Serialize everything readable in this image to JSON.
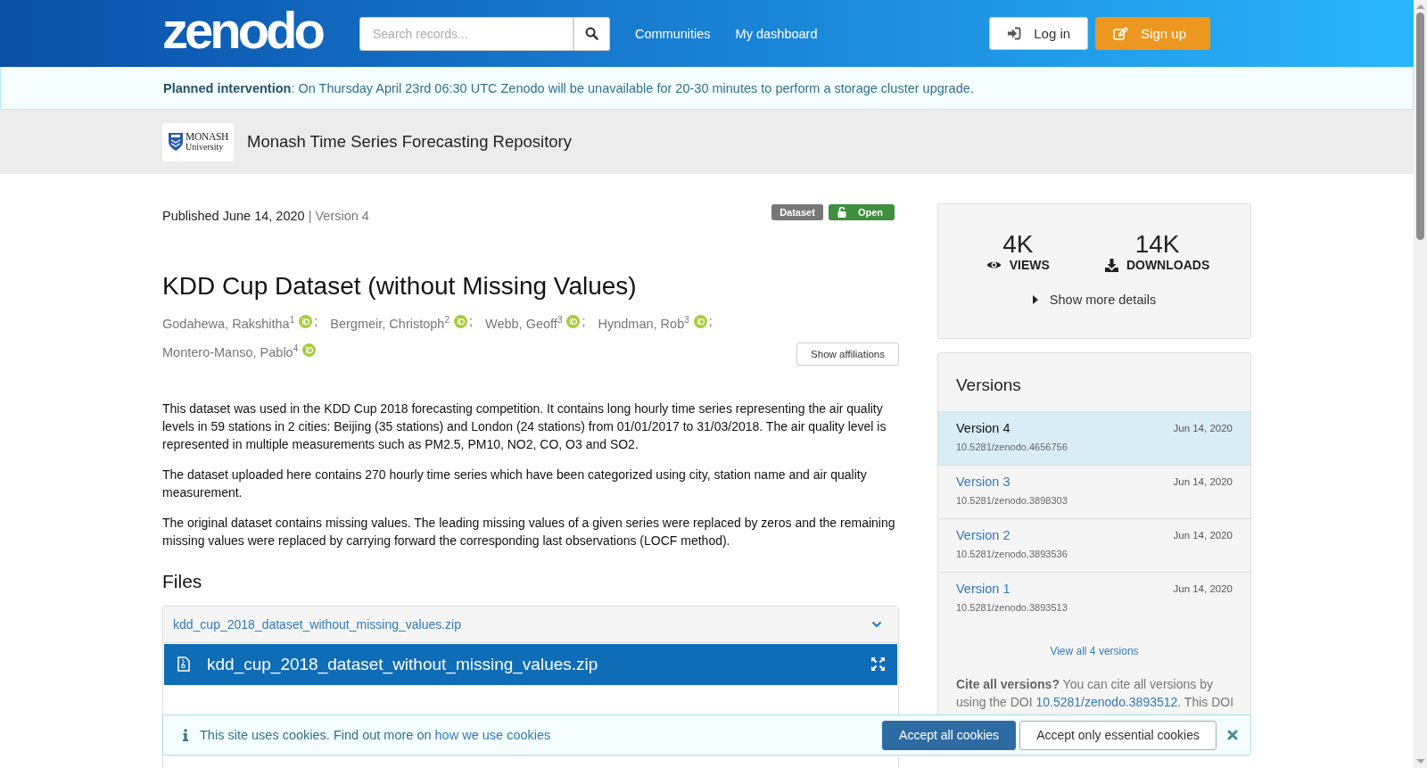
{
  "header": {
    "logo": "zenodo",
    "search": {
      "placeholder": "Search records..."
    },
    "nav": [
      "Communities",
      "My dashboard"
    ],
    "buttons": [
      {
        "kind": "login",
        "label": "Log in"
      },
      {
        "kind": "signup",
        "label": "Sign up"
      }
    ]
  },
  "announcement": "**Planned intervention**: On Thursday April 23rd 06:30 UTC Zenodo will be unavailable for 20-30 minutes to perform a storage cluster upgrade.",
  "community": {
    "logo_lines": [
      "MONASH",
      "University"
    ],
    "title": "Monash Time Series Forecasting Repository"
  },
  "record": {
    "published": "Published June 14, 2020",
    "version": "| Version 4",
    "badges": [
      {
        "kind": "type",
        "label": "Dataset"
      },
      {
        "kind": "access",
        "label": "Open"
      }
    ],
    "title": "KDD Cup Dataset (without Missing Values)",
    "authors": [
      {
        "name": "Godahewa, Rakshitha$^{1}$",
        "separator": ";"
      },
      {
        "name": "Bergmeir, Christoph$^{2}$",
        "separator": ";"
      },
      {
        "name": "Webb, Geoff$^{3}$",
        "separator": ";"
      },
      {
        "name": "Hyndman, Rob$^{3}$",
        "separator": ";"
      },
      {
        "name": "Montero-Manso, Pablo$^{4}$"
      }
    ],
    "show_affiliations": "Show affiliations",
    "description": [
      "This dataset was used in the KDD Cup 2018 forecasting competition. It contains long hourly time series representing the air quality levels in 59 stations in 2 cities: Beijing (35 stations) and London (24 stations) from 01/01/2017 to 31/03/2018. The air quality level is represented in multiple measurements such as PM2.5, PM10, NO2, CO, O3 and SO2.",
      "The dataset uploaded here contains 270 hourly time series which have been categorized using city, station name and air quality measurement.",
      "The original dataset contains missing values. The leading missing values of a given series were replaced by zeros and the remaining missing values were replaced by carrying forward the corresponding last observations (LOCF method)."
    ],
    "files_heading": "Files",
    "file_link": "kdd_cup_2018_dataset_without_missing_values.zip",
    "preview_title": "kdd_cup_2018_dataset_without_missing_values.zip"
  },
  "stats": {
    "items": [
      {
        "kind": "views",
        "value": "4K",
        "label": "VIEWS"
      },
      {
        "kind": "downloads",
        "value": "14K",
        "label": "DOWNLOADS"
      }
    ],
    "more": "Show more details"
  },
  "versions": {
    "heading": "Versions",
    "items": [
      {
        "label": "Version 4",
        "date": "Jun 14, 2020",
        "doi": "10.5281/zenodo.4656756",
        "selected": true
      },
      {
        "label": "Version 3",
        "date": "Jun 14, 2020",
        "doi": "10.5281/zenodo.3898303",
        "selected": false
      },
      {
        "label": "Version 2",
        "date": "Jun 14, 2020",
        "doi": "10.5281/zenodo.3893536",
        "selected": false
      },
      {
        "label": "Version 1",
        "date": "Jun 14, 2020",
        "doi": "10.5281/zenodo.3893513",
        "selected": false
      }
    ],
    "view_all": "View all 4 versions",
    "cite_bold": "Cite all versions?",
    "cite_text": "You can cite all versions by using the DOI",
    "cite_doi": "10.5281/zenodo.3893512",
    "cite_after": ". This DOI"
  },
  "cookies": {
    "text": "This site uses cookies. Find out more on",
    "link": "how we use cookies",
    "buttons": [
      {
        "kind": "primary",
        "label": "Accept all cookies"
      },
      {
        "kind": "secondary",
        "label": "Accept only essential cookies"
      }
    ]
  }
}
